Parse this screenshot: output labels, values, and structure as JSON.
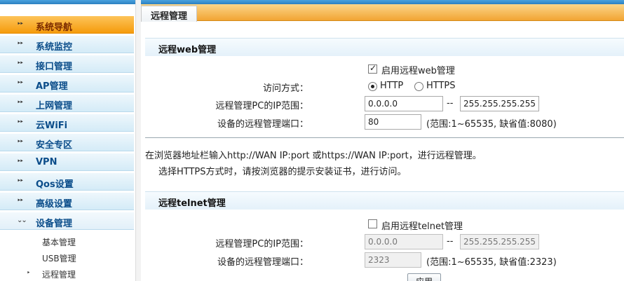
{
  "sidebar": {
    "items": [
      {
        "label": "系统导航",
        "state": "active"
      },
      {
        "label": "系统监控"
      },
      {
        "label": "接口管理"
      },
      {
        "label": "AP管理"
      },
      {
        "label": "上网管理"
      },
      {
        "label": "云WiFi"
      },
      {
        "label": "安全专区"
      },
      {
        "label": "VPN"
      },
      {
        "label": "Qos设置"
      },
      {
        "label": "高级设置"
      },
      {
        "label": "设备管理",
        "state": "expanded"
      }
    ],
    "subitems": [
      {
        "label": "基本管理"
      },
      {
        "label": "USB管理"
      },
      {
        "label": "远程管理",
        "state": "selected"
      }
    ]
  },
  "tab": {
    "label": "远程管理"
  },
  "web_section": {
    "title": "远程web管理",
    "enable_label": "启用远程web管理",
    "enable_checked": true,
    "access_label": "访问方式：",
    "http_label": "HTTP",
    "https_label": "HTTPS",
    "selected_protocol": "HTTP",
    "ip_range_label": "远程管理PC的IP范围：",
    "ip_start": "0.0.0.0",
    "ip_sep": "--",
    "ip_end": "255.255.255.255",
    "port_label": "设备的远程管理端口：",
    "port_value": "80",
    "port_hint": "(范围:1~65535, 缺省值:8080)"
  },
  "notes": {
    "line1": "在浏览器地址栏输入http://WAN IP:port 或https://WAN IP:port，进行远程管理。",
    "line2": "选择HTTPS方式时，请按浏览器的提示安装证书，进行访问。"
  },
  "telnet_section": {
    "title": "远程telnet管理",
    "enable_label": "启用远程telnet管理",
    "enable_checked": false,
    "ip_range_label": "远程管理PC的IP范围：",
    "ip_start": "0.0.0.0",
    "ip_sep": "--",
    "ip_end": "255.255.255.255",
    "port_label": "设备的远程管理端口：",
    "port_value": "2323",
    "port_hint": "(范围:1~65535, 缺省值:2323)"
  },
  "apply_button": {
    "label": "应用"
  },
  "icons": {
    "nav_arrow": "double-chevron-right-icon",
    "expanded_arrow": "double-chevron-down-icon"
  },
  "colors": {
    "accent_orange": "#f59b0c",
    "nav_blue": "#0b4d8a",
    "nav_bg": "#d4ebf7"
  }
}
